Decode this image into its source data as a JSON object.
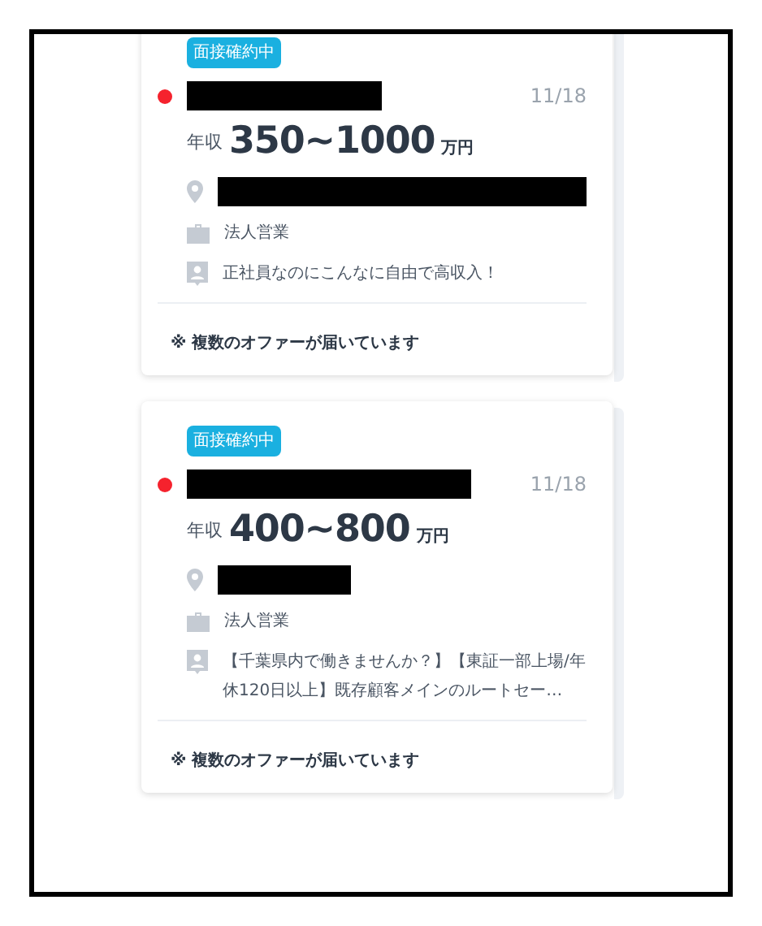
{
  "cards": [
    {
      "badge": "面接確約中",
      "unread": true,
      "title_redacted": true,
      "date": "11/18",
      "salary": {
        "label": "年収",
        "range": "350~1000",
        "unit": "万円"
      },
      "location_redacted": true,
      "job_type": "法人営業",
      "catch_copy": "正社員なのにこんなに自由で高収入！",
      "note": "※ 複数のオファーが届いています"
    },
    {
      "badge": "面接確約中",
      "unread": true,
      "title_redacted": true,
      "date": "11/18",
      "salary": {
        "label": "年収",
        "range": "400~800",
        "unit": "万円"
      },
      "location_redacted": true,
      "job_type": "法人営業",
      "catch_copy": "【千葉県内で働きませんか？】【東証一部上場/年休120日以上】既存顧客メインのルートセー…",
      "note": "※ 複数のオファーが届いています"
    }
  ]
}
